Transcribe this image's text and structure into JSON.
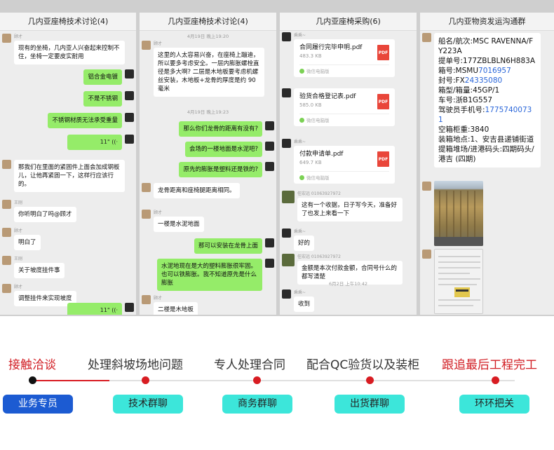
{
  "panels": [
    {
      "title": "几内亚座椅技术讨论(4)",
      "messages": [
        {
          "side": "left",
          "sender": "顾才",
          "text": "现有的坐椅，几内亚人兴奋起来控制不住，坐椅一定要皮实耐用"
        },
        {
          "side": "right",
          "text": "铝合金电镀"
        },
        {
          "side": "right",
          "text": "不是不锈钢"
        },
        {
          "side": "right",
          "text": "不锈钢材质无法承受重量"
        },
        {
          "side": "right",
          "voice": "11\""
        },
        {
          "side": "left",
          "sender": "",
          "text": "那我们在里面的紧固件上面会加成钢板儿，让他再紧固一下，这样行应该行的。"
        },
        {
          "side": "left",
          "sender": "王刚",
          "text": "你听明白了吗@顾才"
        },
        {
          "side": "left",
          "sender": "顾才",
          "text": "明白了"
        },
        {
          "side": "left",
          "sender": "王刚",
          "text": "关于坡度挂件事"
        },
        {
          "side": "left",
          "sender": "顾才",
          "text": "调整挂件来实现坡度"
        },
        {
          "side": "right",
          "voice": "11\""
        }
      ]
    },
    {
      "title": "几内亚座椅技术讨论(4)",
      "times": [
        "4月19日 晚上19:20",
        "4月19日 晚上19:23"
      ],
      "messages": [
        {
          "side": "left",
          "sender": "顾才",
          "text": "这里的人太容易兴奋，在座椅上蹦迪，所以要多考虑安全。一层内膨胀螺栓直径是多大啊? 二层是木地板要考虑机螺丝安装，木地板+龙骨的厚度是约 90 毫米"
        },
        {
          "side": "right",
          "text": "那么你们龙骨的距离有没有?"
        },
        {
          "side": "right",
          "text": "会场的一楼地面是水泥吧?"
        },
        {
          "side": "right",
          "text": "原先的膨胀是塑料还是铁的?"
        },
        {
          "side": "left",
          "sender": "顾才",
          "text": "龙骨距离和座椅腿距离相同。"
        },
        {
          "side": "left",
          "sender": "顾才",
          "text": "一楼是水泥地面"
        },
        {
          "side": "right",
          "text": "那可以安装在龙骨上面"
        },
        {
          "side": "right",
          "text": "水泥地现在是大的塑料膨胀很牢固。也可以铁膨胀。我不知道原先是什么膨胀"
        },
        {
          "side": "left",
          "sender": "顾才",
          "text": "二楼是木地板"
        }
      ]
    },
    {
      "title": "几内亚座椅采购(6)",
      "times": [
        "6月2日 上午10:42"
      ],
      "files": [
        {
          "sender": "乘乘~",
          "name": "合同履行完毕申明.pdf",
          "size": "483.3 KB",
          "source": "微信电脑版"
        },
        {
          "sender": "",
          "name": "验货合格登记表.pdf",
          "size": "585.0 KB",
          "source": "微信电脑版"
        },
        {
          "sender": "乘乘~",
          "name": "付款申请单.pdf",
          "size": "649.7 KB",
          "source": "微信电脑版"
        }
      ],
      "pdf_label": "PDF",
      "messages": [
        {
          "side": "left",
          "sender": "任宏远 01063927972",
          "text": "这有一个收据，日子写今天，准备好了也发上来看一下"
        },
        {
          "side": "left",
          "sender": "乘乘~",
          "text": "好的"
        },
        {
          "side": "left",
          "sender": "任宏远 01063927972",
          "text": "金额是本次付款金额，合同号什么的都写清楚"
        },
        {
          "side": "left",
          "sender": "乘乘~",
          "text": "收到"
        }
      ]
    },
    {
      "title": "几内亚物资发运沟通群",
      "info": [
        {
          "label": "船名/航次:MSC RAVENNA/FY223A",
          "blue": ""
        },
        {
          "label": "提单号:177ZBLBLN6H883A",
          "blue": ""
        },
        {
          "label": "箱号:MSMU",
          "blue": "7016957"
        },
        {
          "label": "封号:FX",
          "blue": "24335080"
        },
        {
          "label": "箱型/箱量:45GP/1",
          "blue": ""
        },
        {
          "label": "车号:浙B1G557",
          "blue": ""
        },
        {
          "label": "驾驶员手机号:",
          "blue": "17757400731"
        },
        {
          "label": "空箱柜重:3840",
          "blue": ""
        },
        {
          "label": "装箱地点:1、安吉县递铺街道",
          "blue": ""
        },
        {
          "label": "提箱堆场/进港码头:四期码头/港吉 (四期)",
          "blue": ""
        }
      ]
    }
  ],
  "steps": [
    {
      "label": "接触洽谈",
      "pill": "业务专员"
    },
    {
      "label": "处理斜坡场地问题",
      "pill": "技术群聊"
    },
    {
      "label": "专人处理合同",
      "pill": "商务群聊"
    },
    {
      "label": "配合QC验货以及装柜",
      "pill": "出货群聊"
    },
    {
      "label": "跟追最后工程完工",
      "pill": "环环把关"
    }
  ],
  "colors": {
    "accent_red": "#d11d23",
    "pill_cyan": "#3ce6da",
    "pill_blue": "#1c5bd2",
    "bubble_green": "#95ec69"
  }
}
